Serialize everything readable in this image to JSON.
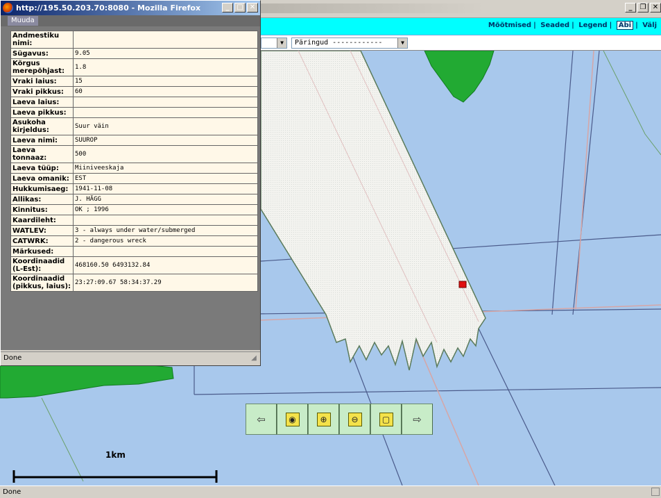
{
  "popup": {
    "title": "http://195.50.203.70:8080 - Mozilla Firefox",
    "edit_button": "Muuda",
    "status": "Done",
    "rows": [
      {
        "label": "Andmestiku nimi:",
        "value": ""
      },
      {
        "label": "Sügavus:",
        "value": "9.05"
      },
      {
        "label": "Kõrgus merepõhjast:",
        "value": "1.8"
      },
      {
        "label": "Vraki laius:",
        "value": "15"
      },
      {
        "label": "Vraki pikkus:",
        "value": "60"
      },
      {
        "label": "Laeva laius:",
        "value": ""
      },
      {
        "label": "Laeva pikkus:",
        "value": ""
      },
      {
        "label": "Asukoha kirjeldus:",
        "value": "Suur väin"
      },
      {
        "label": "Laeva nimi:",
        "value": "SUUROP"
      },
      {
        "label": "Laeva tonnaaz:",
        "value": "500"
      },
      {
        "label": "Laeva tüüp:",
        "value": "Miiniveeskaja"
      },
      {
        "label": "Laeva omanik:",
        "value": "EST"
      },
      {
        "label": "Hukkumisaeg:",
        "value": "1941-11-08"
      },
      {
        "label": "Allikas:",
        "value": "J. HÄGG"
      },
      {
        "label": "Kinnitus:",
        "value": "OK ; 1996"
      },
      {
        "label": "Kaardileht:",
        "value": ""
      },
      {
        "label": "WATLEV:",
        "value": "3 - always under water/submerged"
      },
      {
        "label": "CATWRK:",
        "value": "2 - dangerous wreck"
      },
      {
        "label": "Märkused:",
        "value": ""
      },
      {
        "label": "Koordinaadid (L-Est):",
        "value": "468160.50 6493132.84"
      },
      {
        "label": "Koordinaadid (pikkus, laius):",
        "value": "23:27:09.67 58:34:37.29"
      }
    ]
  },
  "header": {
    "links": [
      "Mõõtmised",
      "Seaded",
      "Legend",
      "Abi",
      "Välj"
    ]
  },
  "dropdowns": {
    "queries": "Päringud ------------"
  },
  "map": {
    "scale_label": "1km"
  },
  "toolbar": {
    "icons": [
      "arrow-left-icon",
      "center-target-icon",
      "zoom-in-icon",
      "zoom-out-icon",
      "full-extent-icon",
      "arrow-right-icon"
    ]
  },
  "status": {
    "text": "Done"
  },
  "colors": {
    "water": "#a8c8ec",
    "land": "#22aa33",
    "channel": "#f2f2ee",
    "header": "#00ffff",
    "wreck": "#e01010"
  }
}
